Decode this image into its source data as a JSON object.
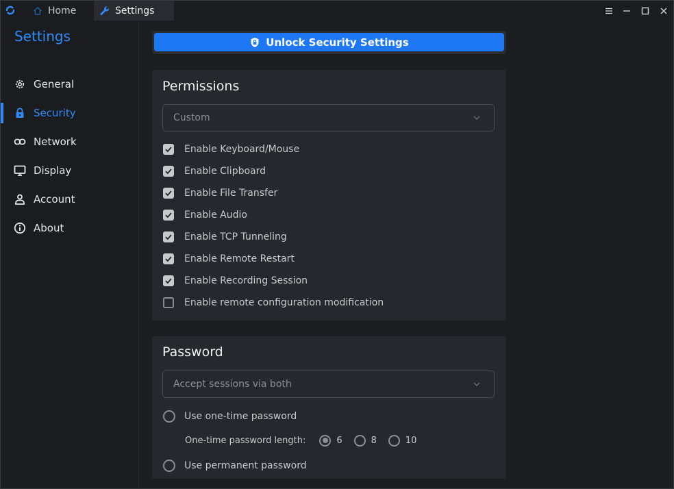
{
  "titlebar": {
    "tabs": [
      {
        "label": "Home",
        "icon": "home-icon"
      },
      {
        "label": "Settings",
        "icon": "wrench-icon"
      }
    ],
    "controls": [
      "menu-icon",
      "minimize-icon",
      "maximize-icon",
      "close-icon"
    ]
  },
  "sidebar": {
    "title": "Settings",
    "items": [
      {
        "label": "General",
        "icon": "gear-icon"
      },
      {
        "label": "Security",
        "icon": "lock-icon",
        "active": true
      },
      {
        "label": "Network",
        "icon": "link-icon"
      },
      {
        "label": "Display",
        "icon": "monitor-icon"
      },
      {
        "label": "Account",
        "icon": "user-icon"
      },
      {
        "label": "About",
        "icon": "info-icon"
      }
    ]
  },
  "main": {
    "unlock_label": "Unlock Security Settings",
    "permissions": {
      "title": "Permissions",
      "preset": "Custom",
      "options": [
        {
          "label": "Enable Keyboard/Mouse",
          "checked": true
        },
        {
          "label": "Enable Clipboard",
          "checked": true
        },
        {
          "label": "Enable File Transfer",
          "checked": true
        },
        {
          "label": "Enable Audio",
          "checked": true
        },
        {
          "label": "Enable TCP Tunneling",
          "checked": true
        },
        {
          "label": "Enable Remote Restart",
          "checked": true
        },
        {
          "label": "Enable Recording Session",
          "checked": true
        },
        {
          "label": "Enable remote configuration modification",
          "checked": false
        }
      ]
    },
    "password": {
      "title": "Password",
      "mode": "Accept sessions via both",
      "one_time_label": "Use one-time password",
      "length_label": "One-time password length:",
      "lengths": [
        "6",
        "8",
        "10"
      ],
      "selected_length": "6",
      "permanent_label": "Use permanent password"
    }
  },
  "colors": {
    "accent": "#2f8cf7",
    "button": "#1e78f6",
    "background": "#1c1d21",
    "card": "#27282d"
  }
}
